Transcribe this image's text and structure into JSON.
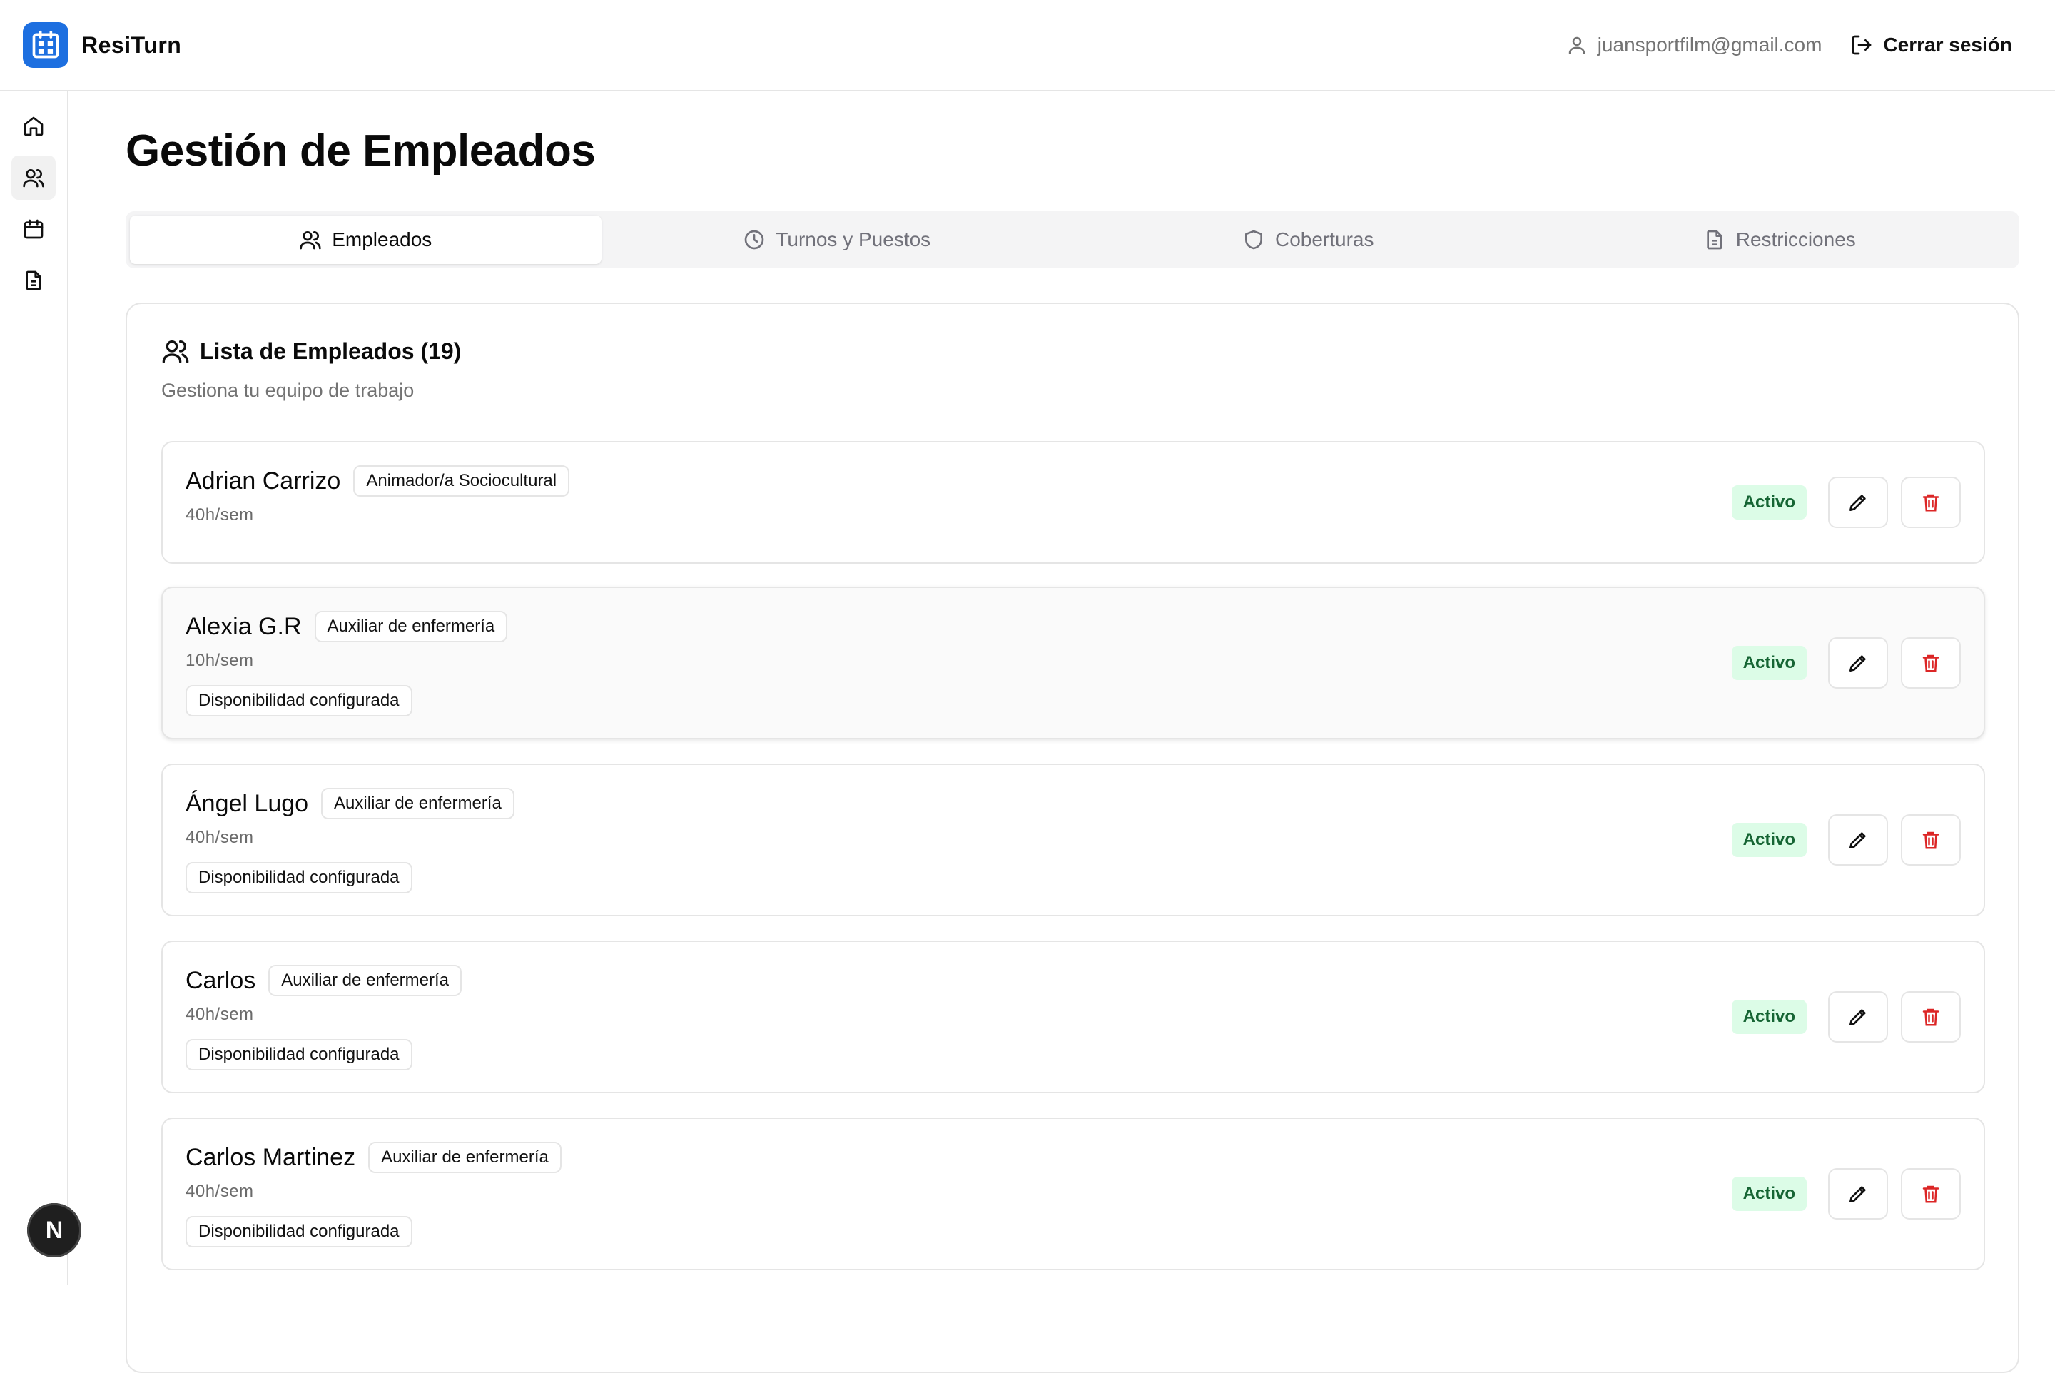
{
  "app": {
    "name": "ResiTurn",
    "brand_color": "#1d6fe0"
  },
  "header": {
    "user_email": "juansportfilm@gmail.com",
    "logout_label": "Cerrar sesión"
  },
  "sidebar": {
    "items": [
      "home-icon",
      "users-icon",
      "calendar-icon",
      "document-icon"
    ],
    "active": 1
  },
  "page": {
    "title": "Gestión de Empleados"
  },
  "tabs": [
    {
      "label": "Empleados",
      "icon": "users-icon",
      "active": true
    },
    {
      "label": "Turnos y Puestos",
      "icon": "clock-icon",
      "active": false
    },
    {
      "label": "Coberturas",
      "icon": "shield-icon",
      "active": false
    },
    {
      "label": "Restricciones",
      "icon": "document-icon",
      "active": false
    }
  ],
  "list": {
    "title": "Lista de Empleados (19)",
    "subtitle": "Gestiona tu equipo de trabajo",
    "employees": [
      {
        "name": "Adrian Carrizo",
        "role": "Animador/a Sociocultural",
        "hours": "40h/sem",
        "availability": "",
        "status": "Activo"
      },
      {
        "name": "Alexia G.R",
        "role": "Auxiliar de enfermería",
        "hours": "10h/sem",
        "availability": "Disponibilidad configurada",
        "status": "Activo"
      },
      {
        "name": "Ángel Lugo",
        "role": "Auxiliar de enfermería",
        "hours": "40h/sem",
        "availability": "Disponibilidad configurada",
        "status": "Activo"
      },
      {
        "name": "Carlos",
        "role": "Auxiliar de enfermería",
        "hours": "40h/sem",
        "availability": "Disponibilidad configurada",
        "status": "Activo"
      },
      {
        "name": "Carlos Martinez",
        "role": "Auxiliar de enfermería",
        "hours": "40h/sem",
        "availability": "Disponibilidad configurada",
        "status": "Activo"
      }
    ]
  },
  "colors": {
    "status_bg": "#dcfce7",
    "status_text": "#166534",
    "delete": "#dc2626"
  },
  "fab": {
    "label": "N"
  }
}
